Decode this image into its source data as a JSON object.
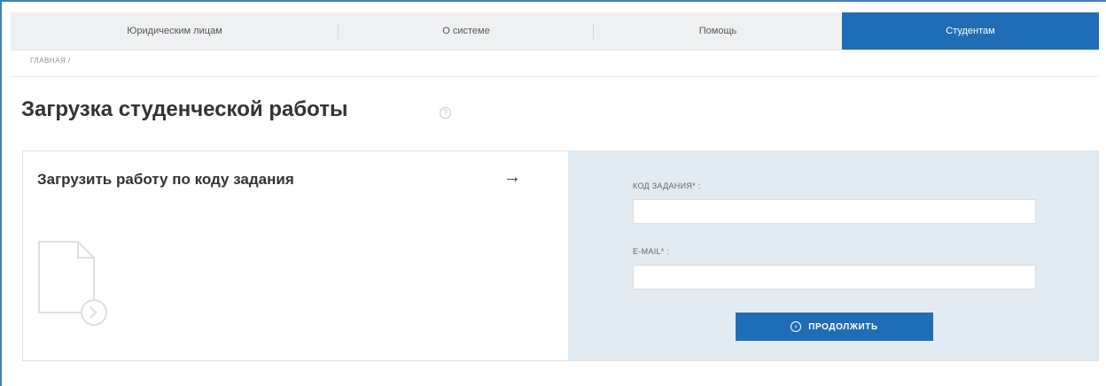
{
  "nav": {
    "items": [
      {
        "label": "Юридическим лицам"
      },
      {
        "label": "О системе"
      },
      {
        "label": "Помощь"
      },
      {
        "label": "Студентам"
      }
    ],
    "active_index": 3
  },
  "breadcrumb": "Главная /",
  "page": {
    "title": "Загрузка студенческой работы"
  },
  "upload_card": {
    "title": "Загрузить работу по коду задания",
    "form": {
      "task_code_label": "Код задания* :",
      "task_code_value": "",
      "email_label": "E-mail* :",
      "email_value": "",
      "continue_label": "Продолжить"
    }
  },
  "icons": {
    "help": "help-icon",
    "arrow": "arrow-right-icon",
    "document": "document-upload-icon",
    "continue": "arrow-circle-right-icon"
  },
  "colors": {
    "accent": "#1f6db5",
    "nav_bg": "#eef0f2",
    "form_panel_bg": "#e3ebf2"
  }
}
